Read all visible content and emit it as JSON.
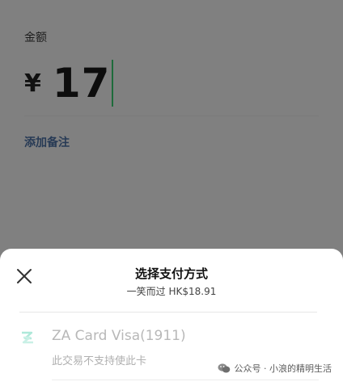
{
  "amount": {
    "label": "金额",
    "currency": "¥",
    "value": "17"
  },
  "add_note": "添加备注",
  "sheet": {
    "title": "选择支付方式",
    "subtitle": "一笑而过 HK$18.91",
    "option": {
      "name": "ZA Card Visa(1911)",
      "note": "此交易不支持使此卡",
      "icon": "za-logo-icon"
    }
  },
  "watermark": "公众号 · 小浪的精明生活",
  "colors": {
    "overlay": "#808080",
    "cursor": "#1e6b3b",
    "note_link": "#273a55"
  }
}
